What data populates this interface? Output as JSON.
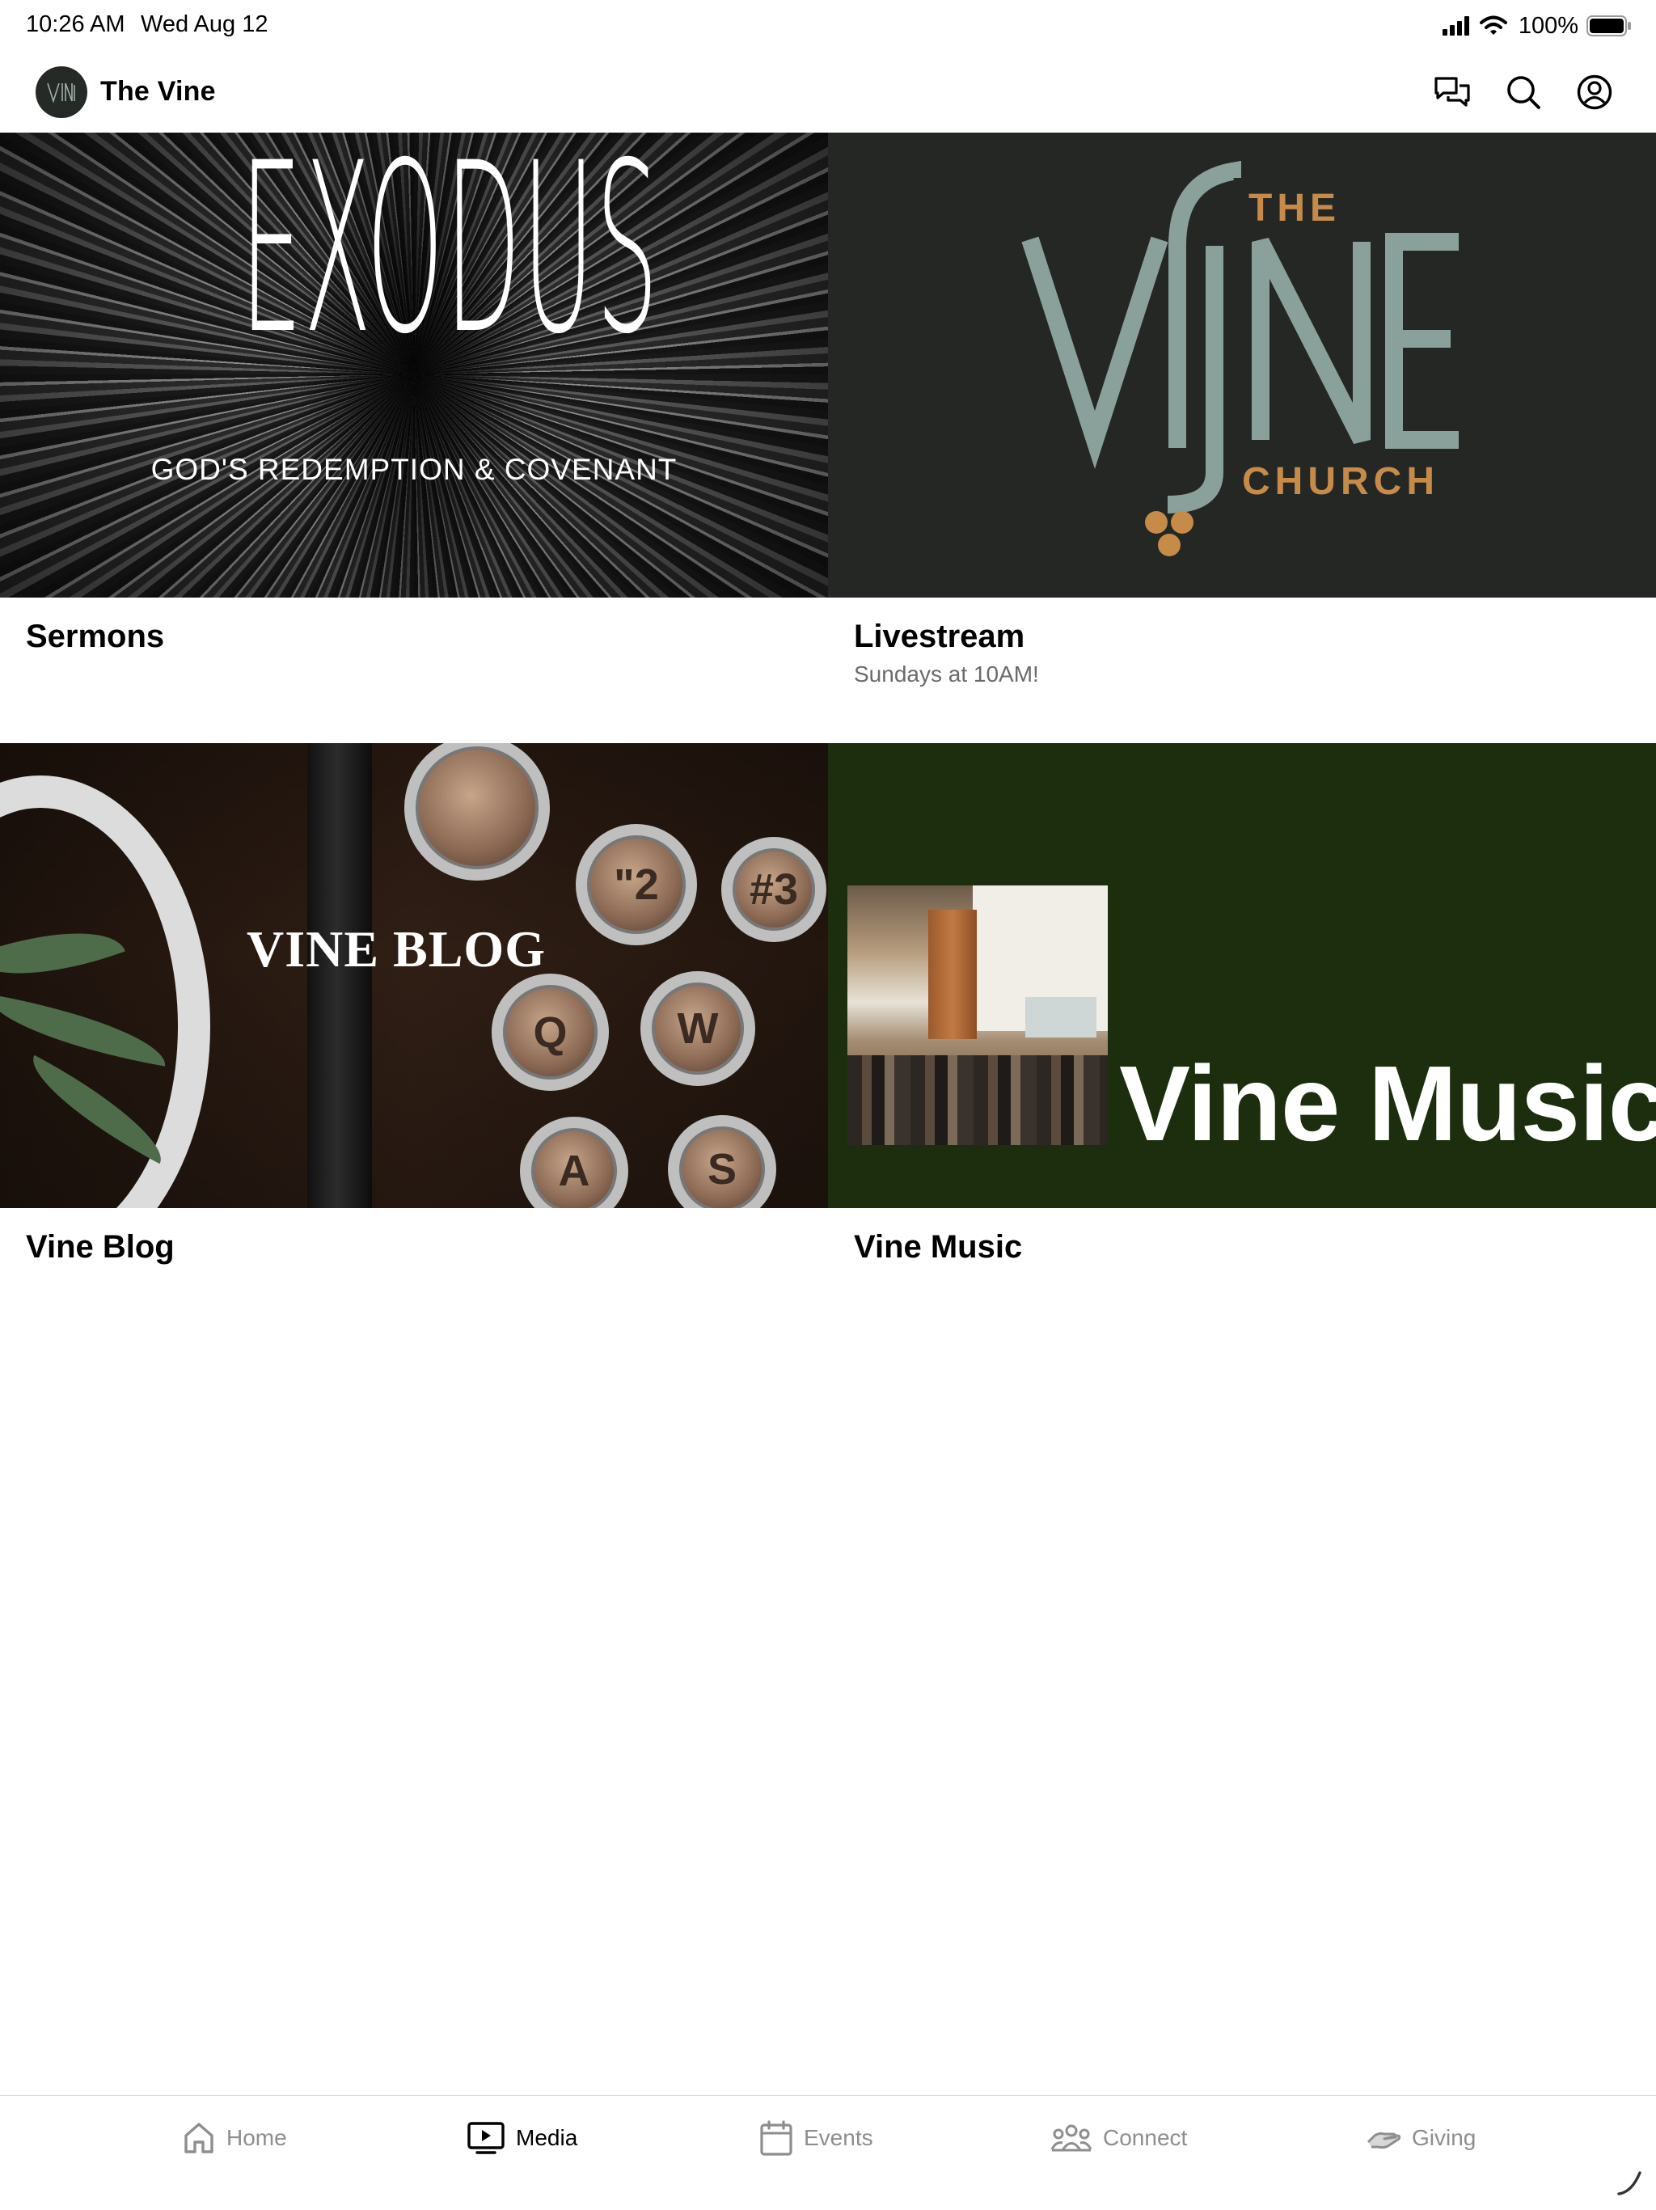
{
  "status_bar": {
    "time": "10:26 AM",
    "date": "Wed Aug 12",
    "battery": "100%"
  },
  "header": {
    "title": "The Vine",
    "icons": [
      "chat-icon",
      "search-icon",
      "account-icon"
    ]
  },
  "tiles": [
    {
      "title": "Sermons",
      "subtitle": "",
      "art": {
        "headline": "EXODUS",
        "tagline": "GOD'S REDEMPTION & COVENANT"
      }
    },
    {
      "title": "Livestream",
      "subtitle": "Sundays at 10AM!",
      "art": {
        "the": "THE",
        "word": "VINE",
        "church": "CHURCH"
      }
    },
    {
      "title": "Vine Blog",
      "subtitle": "",
      "art": {
        "headline": "VINE BLOG",
        "keys": [
          "\"2",
          "#3",
          "Q",
          "W",
          "A",
          "S"
        ]
      }
    },
    {
      "title": "Vine Music",
      "subtitle": "",
      "art": {
        "headline": "Vine Music"
      }
    }
  ],
  "tab_bar": {
    "tabs": [
      {
        "label": "Home",
        "icon": "home-icon",
        "active": false
      },
      {
        "label": "Media",
        "icon": "media-icon",
        "active": true
      },
      {
        "label": "Events",
        "icon": "calendar-icon",
        "active": false
      },
      {
        "label": "Connect",
        "icon": "people-icon",
        "active": false
      },
      {
        "label": "Giving",
        "icon": "giving-icon",
        "active": false
      }
    ]
  },
  "colors": {
    "vine_sage": "#8aa19b",
    "vine_gold": "#c68a49",
    "vine_dark": "#252725",
    "music_green": "#1c2e0e",
    "inactive_gray": "#8e8e8e"
  }
}
